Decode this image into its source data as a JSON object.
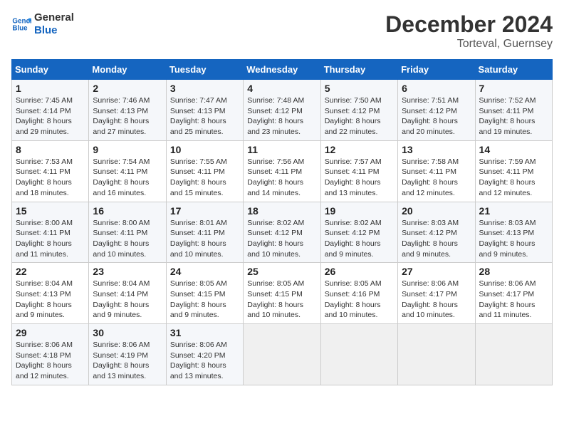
{
  "header": {
    "logo_line1": "General",
    "logo_line2": "Blue",
    "month_year": "December 2024",
    "location": "Torteval, Guernsey"
  },
  "days_of_week": [
    "Sunday",
    "Monday",
    "Tuesday",
    "Wednesday",
    "Thursday",
    "Friday",
    "Saturday"
  ],
  "weeks": [
    [
      {
        "day": "1",
        "sunrise": "7:45 AM",
        "sunset": "4:14 PM",
        "daylight": "8 hours and 29 minutes."
      },
      {
        "day": "2",
        "sunrise": "7:46 AM",
        "sunset": "4:13 PM",
        "daylight": "8 hours and 27 minutes."
      },
      {
        "day": "3",
        "sunrise": "7:47 AM",
        "sunset": "4:13 PM",
        "daylight": "8 hours and 25 minutes."
      },
      {
        "day": "4",
        "sunrise": "7:48 AM",
        "sunset": "4:12 PM",
        "daylight": "8 hours and 23 minutes."
      },
      {
        "day": "5",
        "sunrise": "7:50 AM",
        "sunset": "4:12 PM",
        "daylight": "8 hours and 22 minutes."
      },
      {
        "day": "6",
        "sunrise": "7:51 AM",
        "sunset": "4:12 PM",
        "daylight": "8 hours and 20 minutes."
      },
      {
        "day": "7",
        "sunrise": "7:52 AM",
        "sunset": "4:11 PM",
        "daylight": "8 hours and 19 minutes."
      }
    ],
    [
      {
        "day": "8",
        "sunrise": "7:53 AM",
        "sunset": "4:11 PM",
        "daylight": "8 hours and 18 minutes."
      },
      {
        "day": "9",
        "sunrise": "7:54 AM",
        "sunset": "4:11 PM",
        "daylight": "8 hours and 16 minutes."
      },
      {
        "day": "10",
        "sunrise": "7:55 AM",
        "sunset": "4:11 PM",
        "daylight": "8 hours and 15 minutes."
      },
      {
        "day": "11",
        "sunrise": "7:56 AM",
        "sunset": "4:11 PM",
        "daylight": "8 hours and 14 minutes."
      },
      {
        "day": "12",
        "sunrise": "7:57 AM",
        "sunset": "4:11 PM",
        "daylight": "8 hours and 13 minutes."
      },
      {
        "day": "13",
        "sunrise": "7:58 AM",
        "sunset": "4:11 PM",
        "daylight": "8 hours and 12 minutes."
      },
      {
        "day": "14",
        "sunrise": "7:59 AM",
        "sunset": "4:11 PM",
        "daylight": "8 hours and 12 minutes."
      }
    ],
    [
      {
        "day": "15",
        "sunrise": "8:00 AM",
        "sunset": "4:11 PM",
        "daylight": "8 hours and 11 minutes."
      },
      {
        "day": "16",
        "sunrise": "8:00 AM",
        "sunset": "4:11 PM",
        "daylight": "8 hours and 10 minutes."
      },
      {
        "day": "17",
        "sunrise": "8:01 AM",
        "sunset": "4:11 PM",
        "daylight": "8 hours and 10 minutes."
      },
      {
        "day": "18",
        "sunrise": "8:02 AM",
        "sunset": "4:12 PM",
        "daylight": "8 hours and 10 minutes."
      },
      {
        "day": "19",
        "sunrise": "8:02 AM",
        "sunset": "4:12 PM",
        "daylight": "8 hours and 9 minutes."
      },
      {
        "day": "20",
        "sunrise": "8:03 AM",
        "sunset": "4:12 PM",
        "daylight": "8 hours and 9 minutes."
      },
      {
        "day": "21",
        "sunrise": "8:03 AM",
        "sunset": "4:13 PM",
        "daylight": "8 hours and 9 minutes."
      }
    ],
    [
      {
        "day": "22",
        "sunrise": "8:04 AM",
        "sunset": "4:13 PM",
        "daylight": "8 hours and 9 minutes."
      },
      {
        "day": "23",
        "sunrise": "8:04 AM",
        "sunset": "4:14 PM",
        "daylight": "8 hours and 9 minutes."
      },
      {
        "day": "24",
        "sunrise": "8:05 AM",
        "sunset": "4:15 PM",
        "daylight": "8 hours and 9 minutes."
      },
      {
        "day": "25",
        "sunrise": "8:05 AM",
        "sunset": "4:15 PM",
        "daylight": "8 hours and 10 minutes."
      },
      {
        "day": "26",
        "sunrise": "8:05 AM",
        "sunset": "4:16 PM",
        "daylight": "8 hours and 10 minutes."
      },
      {
        "day": "27",
        "sunrise": "8:06 AM",
        "sunset": "4:17 PM",
        "daylight": "8 hours and 10 minutes."
      },
      {
        "day": "28",
        "sunrise": "8:06 AM",
        "sunset": "4:17 PM",
        "daylight": "8 hours and 11 minutes."
      }
    ],
    [
      {
        "day": "29",
        "sunrise": "8:06 AM",
        "sunset": "4:18 PM",
        "daylight": "8 hours and 12 minutes."
      },
      {
        "day": "30",
        "sunrise": "8:06 AM",
        "sunset": "4:19 PM",
        "daylight": "8 hours and 13 minutes."
      },
      {
        "day": "31",
        "sunrise": "8:06 AM",
        "sunset": "4:20 PM",
        "daylight": "8 hours and 13 minutes."
      },
      null,
      null,
      null,
      null
    ]
  ],
  "labels": {
    "sunrise": "Sunrise: ",
    "sunset": "Sunset: ",
    "daylight": "Daylight: "
  }
}
